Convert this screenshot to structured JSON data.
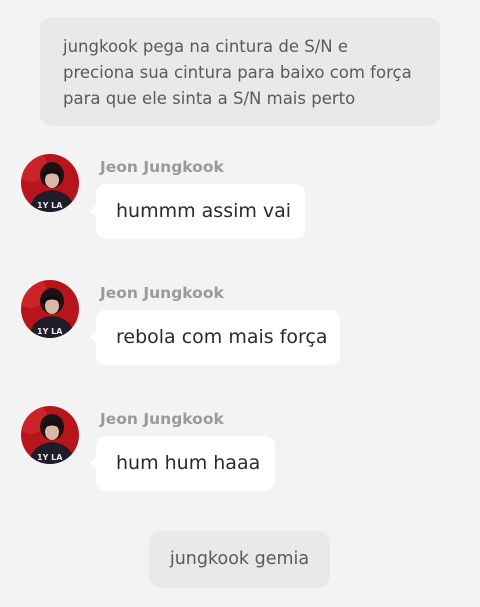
{
  "narration_top": {
    "line1": "jungkook pega na cintura de S/N e",
    "line2": "preciona sua cintura para baixo com força",
    "line3": "para que  ele sinta a S/N mais perto"
  },
  "messages": [
    {
      "sender": "Jeon Jungkook",
      "text": "hummm assim vai",
      "avatar_icon": "avatar-photo"
    },
    {
      "sender": "Jeon Jungkook",
      "text": "rebola com mais força",
      "avatar_icon": "avatar-photo"
    },
    {
      "sender": "Jeon Jungkook",
      "text": "hum hum haaa",
      "avatar_icon": "avatar-photo"
    }
  ],
  "narration_bottom": {
    "text": "jungkook gemia"
  },
  "colors": {
    "background": "#f3f3f3",
    "narration_bubble": "#e9e9e9",
    "message_bubble": "#ffffff",
    "sender_name": "#9a9a9a",
    "avatar_accent": "#b8141c"
  }
}
